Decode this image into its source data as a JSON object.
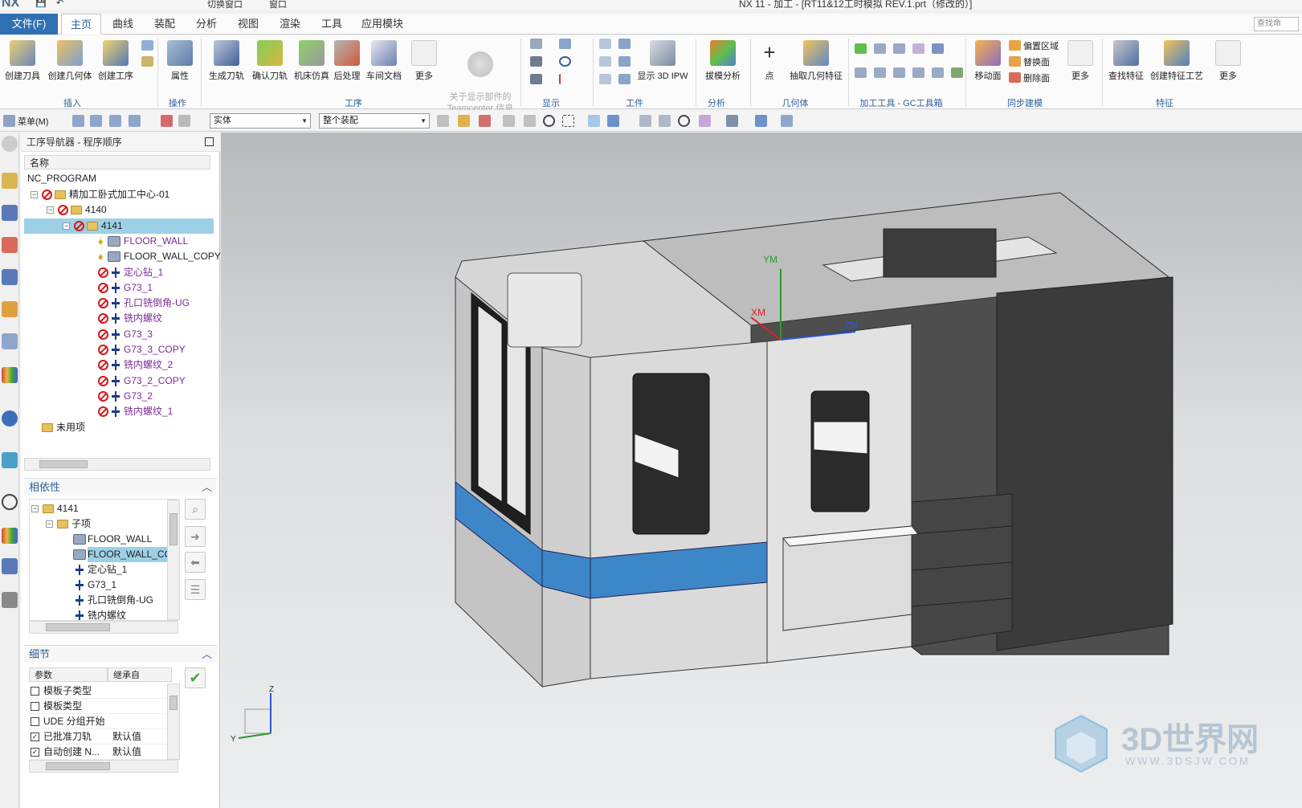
{
  "titlebar": {
    "logo": "NX",
    "title": "NX 11 - 加工 - [RT11&12工时模拟 REV.1.prt（修改的）]",
    "switch_window": "切换窗口",
    "window_menu": "窗口"
  },
  "ribbon_tabs": {
    "file": "文件(F)",
    "tabs": [
      "主页",
      "曲线",
      "装配",
      "分析",
      "视图",
      "渲染",
      "工具",
      "应用模块"
    ],
    "active": "主页",
    "command_search_placeholder": "查找命"
  },
  "ribbon": {
    "insert": {
      "label": "插入",
      "buttons": [
        "创建刀具",
        "创建几何体",
        "创建工序"
      ]
    },
    "operations": {
      "label": "操作",
      "buttons": [
        "属性"
      ]
    },
    "process": {
      "label": "工序",
      "buttons": [
        "生成刀轨",
        "确认刀轨",
        "机床仿真",
        "后处理",
        "车间文档",
        "更多"
      ],
      "teamcenter": "关于显示部件的\nTeamcenter 信息"
    },
    "display": {
      "label": "显示"
    },
    "workpiece": {
      "label": "工件",
      "buttons": [
        "显示 3D IPW"
      ]
    },
    "analysis": {
      "label": "分析",
      "buttons": [
        "拔模分析"
      ]
    },
    "geometry": {
      "label": "几何体",
      "buttons": [
        "点",
        "抽取几何特征"
      ]
    },
    "gc_toolkit": {
      "label": "加工工具 - GC工具箱"
    },
    "sync_modeling": {
      "label": "同步建模",
      "buttons": [
        "移动面",
        "更多"
      ],
      "small_items": [
        "偏置区域",
        "替换面",
        "删除面"
      ]
    },
    "features": {
      "label": "特征",
      "buttons": [
        "查找特征",
        "创建特征工艺",
        "更多"
      ]
    }
  },
  "toolbar2": {
    "menu": "菜单(M)",
    "filter_type": "实体",
    "filter_scope": "整个装配"
  },
  "navigator": {
    "title": "工序导航器 - 程序顺序",
    "column_name": "名称",
    "root": "NC_PROGRAM",
    "tree": [
      {
        "label": "精加工卧式加工中心-01",
        "kind": "program",
        "level": 1
      },
      {
        "label": "4140",
        "kind": "program",
        "level": 2
      },
      {
        "label": "4141",
        "kind": "program",
        "level": 3,
        "selected": true
      },
      {
        "label": "FLOOR_WALL",
        "kind": "geometry-op",
        "level": 4,
        "purple": true
      },
      {
        "label": "FLOOR_WALL_COPY",
        "kind": "geometry-op",
        "level": 4,
        "purple": false
      },
      {
        "label": "定心钻_1",
        "kind": "tool-op",
        "level": 4,
        "purple": true
      },
      {
        "label": "G73_1",
        "kind": "tool-op",
        "level": 4,
        "purple": true
      },
      {
        "label": "孔口铣倒角-UG",
        "kind": "tool-op",
        "level": 4,
        "purple": true
      },
      {
        "label": "铣内螺纹",
        "kind": "tool-op",
        "level": 4,
        "purple": true
      },
      {
        "label": "G73_3",
        "kind": "tool-op",
        "level": 4,
        "purple": true
      },
      {
        "label": "G73_3_COPY",
        "kind": "tool-op",
        "level": 4,
        "purple": true
      },
      {
        "label": "铣内螺纹_2",
        "kind": "tool-op",
        "level": 4,
        "purple": true
      },
      {
        "label": "G73_2_COPY",
        "kind": "tool-op",
        "level": 4,
        "purple": true
      },
      {
        "label": "G73_2",
        "kind": "tool-op",
        "level": 4,
        "purple": true
      },
      {
        "label": "铣内螺纹_1",
        "kind": "tool-op",
        "level": 4,
        "purple": true
      },
      {
        "label": "未用项",
        "kind": "folder",
        "level": 1
      }
    ]
  },
  "dependency": {
    "title": "相依性",
    "tree": [
      {
        "label": "4141",
        "kind": "program"
      },
      {
        "label": "子项",
        "kind": "folder"
      },
      {
        "label": "FLOOR_WALL",
        "kind": "geometry-op"
      },
      {
        "label": "FLOOR_WALL_CO",
        "kind": "geometry-op",
        "selected": true
      },
      {
        "label": "定心钻_1",
        "kind": "tool-op"
      },
      {
        "label": "G73_1",
        "kind": "tool-op"
      },
      {
        "label": "孔口铣倒角-UG",
        "kind": "tool-op"
      },
      {
        "label": "铣内螺纹",
        "kind": "tool-op"
      }
    ]
  },
  "details": {
    "title": "细节",
    "columns": [
      "参数",
      "继承自"
    ],
    "rows": [
      {
        "param": "模板子类型",
        "inherit": "",
        "checked": false
      },
      {
        "param": "模板类型",
        "inherit": "",
        "checked": false
      },
      {
        "param": "UDE 分组开始",
        "inherit": "",
        "checked": false
      },
      {
        "param": "已批准刀轨",
        "inherit": "默认值",
        "checked": true
      },
      {
        "param": "自动创建 N...",
        "inherit": "默认值",
        "checked": true
      }
    ]
  },
  "viewport": {
    "axes_labels": {
      "y": "YM",
      "x": "XM",
      "z": "ZM"
    },
    "triad_labels": {
      "z": "Z",
      "y": "Y"
    },
    "watermark": {
      "text": "3D世界网",
      "url": "WWW.3DSJW.COM"
    }
  },
  "colors": {
    "file_tab": "#2f6fb3",
    "selection": "#9dd0e6",
    "stopped": "#d31b1b",
    "machine_blue_stripe": "#3d87c9",
    "machine_dark": "#4a4a4a",
    "machine_light": "#d4d4d4"
  }
}
